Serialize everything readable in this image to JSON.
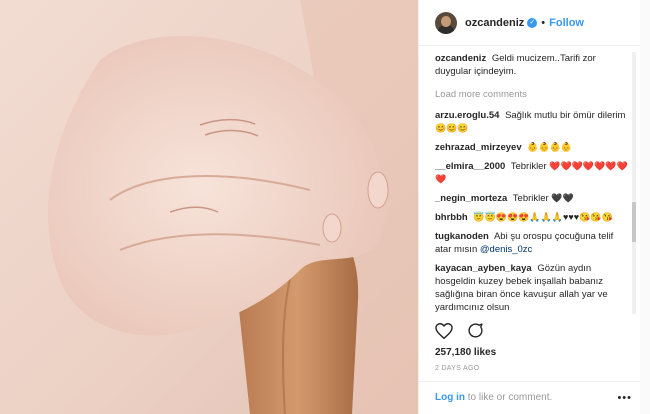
{
  "post": {
    "username": "ozcandeniz",
    "verified_icon": "verified-badge-icon",
    "separator": "•",
    "follow_label": "Follow",
    "caption": "Geldi mucizem..Tarifi zor duygular içindeyim.",
    "load_more": "Load more comments",
    "likes": "257,180 likes",
    "time_ago": "2 DAYS AGO",
    "more_icon": "more-options-icon"
  },
  "comments": [
    {
      "user": "arzu.eroglu.54",
      "text": "Sağlık mutlu bir ömür dilerim",
      "emoji": "😊😊😊"
    },
    {
      "user": "zehrazad_mirzeyev",
      "text": "",
      "emoji": "👶👶👶👶"
    },
    {
      "user": "__elmira__2000",
      "text": "Tebrikler",
      "emoji": "❤️❤️❤️❤️❤️❤️❤️❤️"
    },
    {
      "user": "_negin_morteza",
      "text": "Tebrikler",
      "emoji": "🖤🖤"
    },
    {
      "user": "bhrbbh",
      "text": "",
      "emoji": "😇😇😍😍😍🙏🙏🙏♥♥♥😘😘😘"
    },
    {
      "user": "tugkanoden",
      "text": "Abi şu orospu çocuğuna telif atar mısın",
      "mention": "@denis_0zc"
    },
    {
      "user": "kayacan_ayben_kaya",
      "text": "Gözün aydın hosgeldin kuzey bebek inşallah babanız sağlığına biran önce kavuşur allah yar ve yardımcınız olsun",
      "emoji": ""
    }
  ],
  "footer": {
    "login": "Log in",
    "rest": "to like or comment."
  },
  "colors": {
    "accent": "#3897f0",
    "text": "#262626",
    "muted": "#999999",
    "heart": "#ed4956"
  }
}
